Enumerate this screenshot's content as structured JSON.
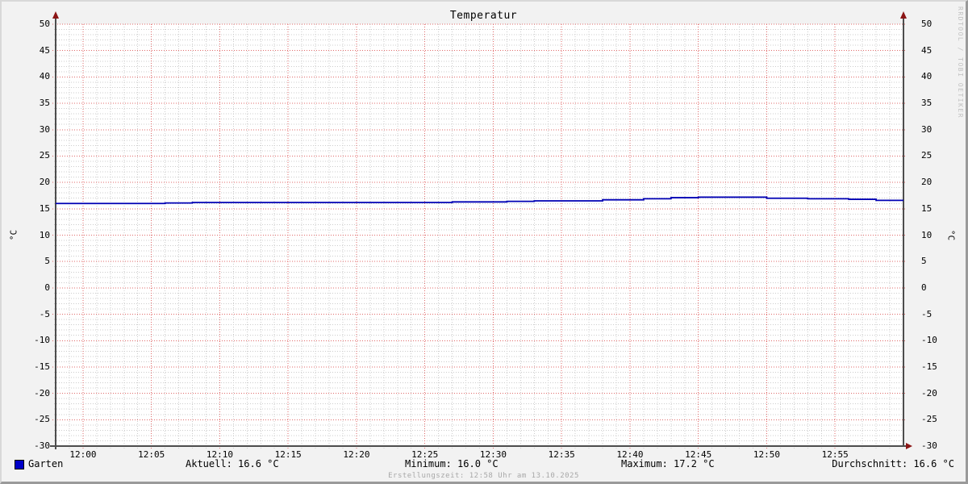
{
  "title": "Temperatur",
  "watermark": "RRDTOOL / TOBI OETIKER",
  "footer_note": "Erstellungszeit: 12:58 Uhr am 13.10.2025",
  "legend": {
    "label": "Garten",
    "color": "#0000c8"
  },
  "stats": {
    "aktuell": "Aktuell: 16.6 °C",
    "minimum": "Minimum: 16.0 °C",
    "maximum": "Maximum: 17.2 °C",
    "durchschnitt": "Durchschnitt: 16.6 °C"
  },
  "chart_data": {
    "type": "line",
    "title": "Temperatur",
    "ylabel": "°C",
    "xlabel": "",
    "ylim": [
      -30,
      50
    ],
    "y_tick_step": 5,
    "y_minor_step": 1,
    "xlim_minutes": [
      -2,
      60
    ],
    "x_minor_step_minutes": 1,
    "grid": true,
    "legend_position": "bottom-left",
    "y_ticks": [
      50,
      45,
      40,
      35,
      30,
      25,
      20,
      15,
      10,
      5,
      0,
      -5,
      -10,
      -15,
      -20,
      -25,
      -30
    ],
    "x_ticks": [
      {
        "minute": 0,
        "label": "12:00"
      },
      {
        "minute": 5,
        "label": "12:05"
      },
      {
        "minute": 10,
        "label": "12:10"
      },
      {
        "minute": 15,
        "label": "12:15"
      },
      {
        "minute": 20,
        "label": "12:20"
      },
      {
        "minute": 25,
        "label": "12:25"
      },
      {
        "minute": 30,
        "label": "12:30"
      },
      {
        "minute": 35,
        "label": "12:35"
      },
      {
        "minute": 40,
        "label": "12:40"
      },
      {
        "minute": 45,
        "label": "12:45"
      },
      {
        "minute": 50,
        "label": "12:50"
      },
      {
        "minute": 55,
        "label": "12:55"
      }
    ],
    "series": [
      {
        "name": "Garten",
        "color": "#0000b4",
        "style": "step",
        "points": [
          [
            -2,
            16.0
          ],
          [
            6,
            16.1
          ],
          [
            8,
            16.2
          ],
          [
            27,
            16.3
          ],
          [
            31,
            16.4
          ],
          [
            33,
            16.5
          ],
          [
            38,
            16.7
          ],
          [
            41,
            16.9
          ],
          [
            43,
            17.1
          ],
          [
            45,
            17.2
          ],
          [
            50,
            17.0
          ],
          [
            53,
            16.9
          ],
          [
            56,
            16.8
          ],
          [
            58,
            16.6
          ],
          [
            60,
            16.6
          ]
        ]
      }
    ],
    "summary": {
      "aktuell": 16.6,
      "minimum": 16.0,
      "maximum": 17.2,
      "durchschnitt": 16.6
    },
    "colors": {
      "canvas": "#ffffff",
      "background": "#f2f2f2",
      "major_grid": "#e06a6a",
      "minor_grid": "#cccccc",
      "axis": "#4d4d4d",
      "arrow": "#8b1414",
      "text": "#000000"
    }
  }
}
